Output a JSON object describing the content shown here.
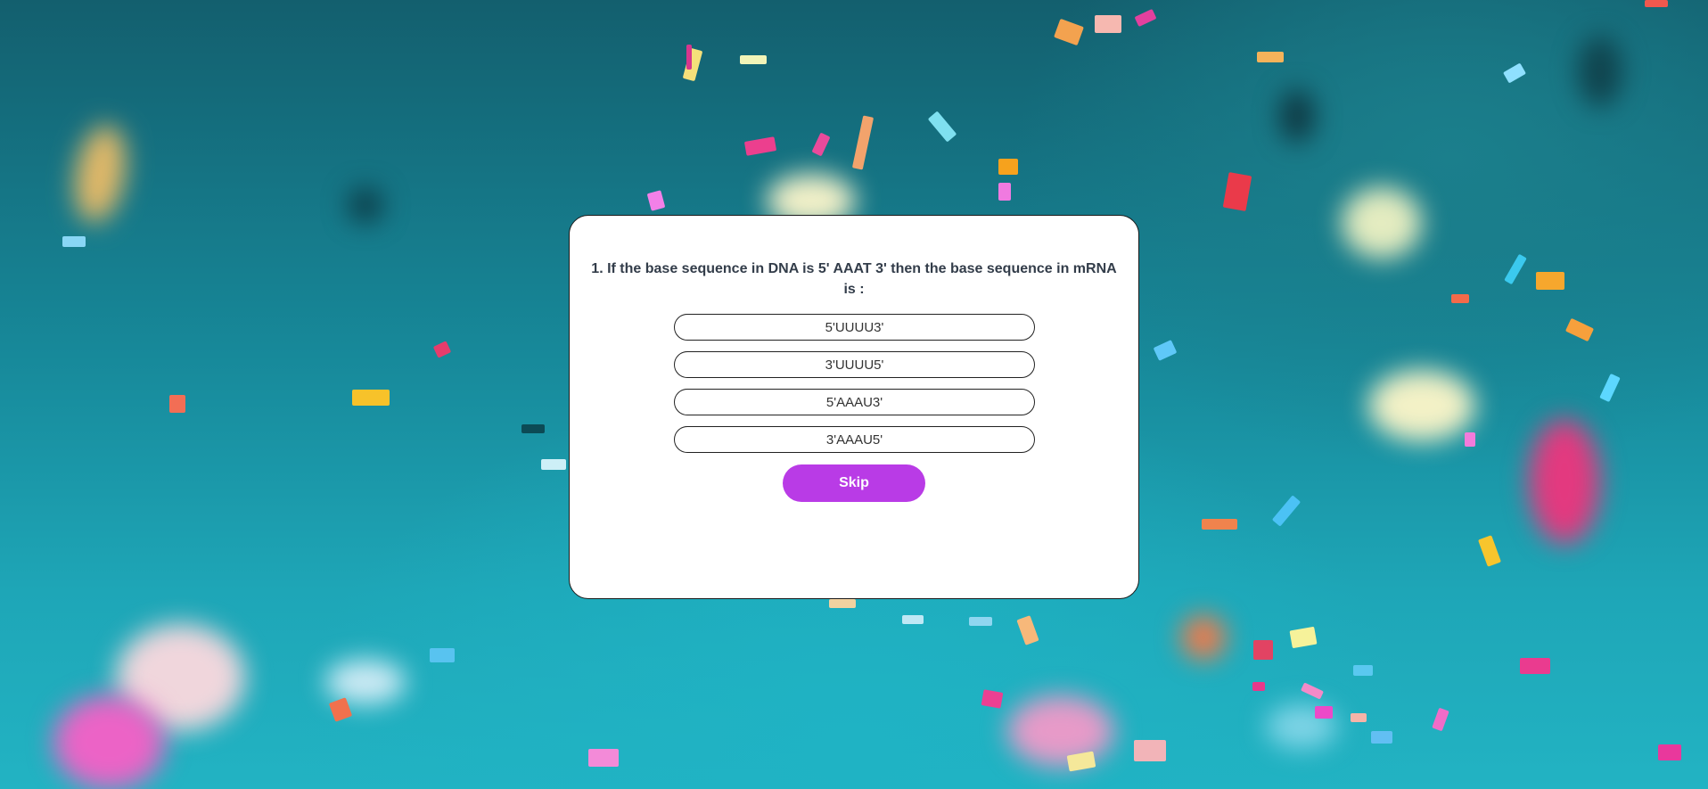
{
  "quiz": {
    "question": "1. If the base sequence in DNA is 5' AAAT 3' then the base sequence in mRNA is :",
    "options": [
      "5'UUUU3'",
      "3'UUUU5'",
      "5'AAAU3'",
      "3'AAAU5'"
    ],
    "skip_label": "Skip"
  },
  "colors": {
    "skip_button": "#b93be6",
    "card_background": "#ffffff",
    "background": "#1a8a9a"
  }
}
